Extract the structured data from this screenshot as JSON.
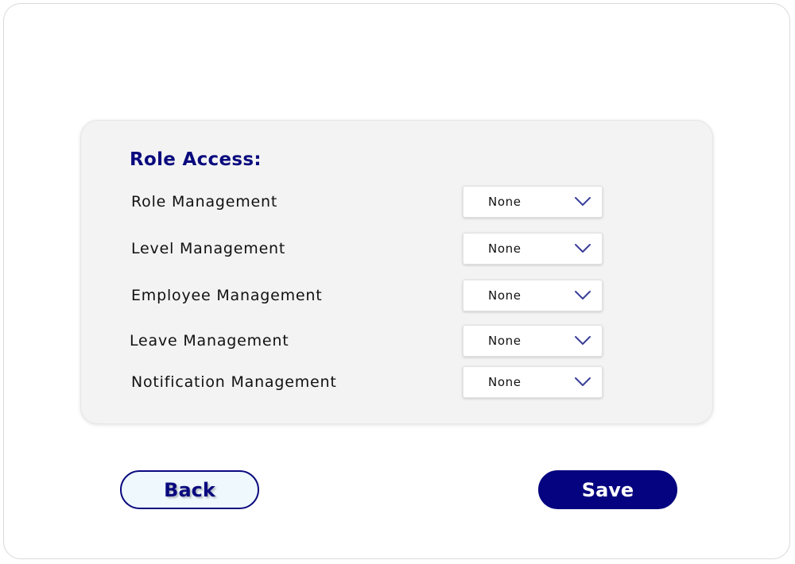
{
  "section_title": "Role Access:",
  "rows": [
    {
      "label": "Role Management",
      "value": "None"
    },
    {
      "label": "Level Management",
      "value": "None"
    },
    {
      "label": "Employee Management",
      "value": "None"
    },
    {
      "label": "Leave Management",
      "value": "None"
    },
    {
      "label": "Notification Management",
      "value": "None"
    }
  ],
  "buttons": {
    "back_label": "Back",
    "save_label": "Save"
  },
  "icons": {
    "dropdown": "chevron-down-icon"
  },
  "colors": {
    "accent": "#0a0a7e",
    "save_bg": "#05037f",
    "back_bg": "#eef8fd",
    "card_bg": "#f3f3f3",
    "chevron": "#3a3f99"
  }
}
